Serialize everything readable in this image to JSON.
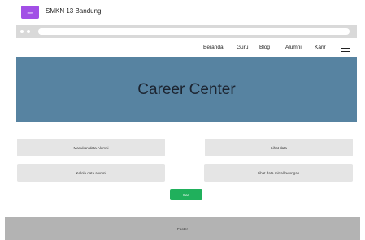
{
  "header": {
    "logo_text": "mm",
    "site_title": "SMKN 13 Bandung"
  },
  "nav": {
    "items": [
      "Beranda",
      "Guru",
      "Blog",
      "Alumni",
      "Karir"
    ]
  },
  "hero": {
    "title": "Career Center"
  },
  "cards": {
    "top_left": "Masukan data Alumni",
    "top_right": "Lihat data",
    "bottom_left": "Kelola data alumni",
    "bottom_right": "Lihat data mitra/lowongan"
  },
  "actions": {
    "primary_label": "Cari"
  },
  "footer": {
    "text": "Footer"
  },
  "colors": {
    "accent_logo": "#a24fe6",
    "hero_bg": "#5783a1",
    "button_green": "#20b05c",
    "footer_bg": "#b3b3b3"
  }
}
